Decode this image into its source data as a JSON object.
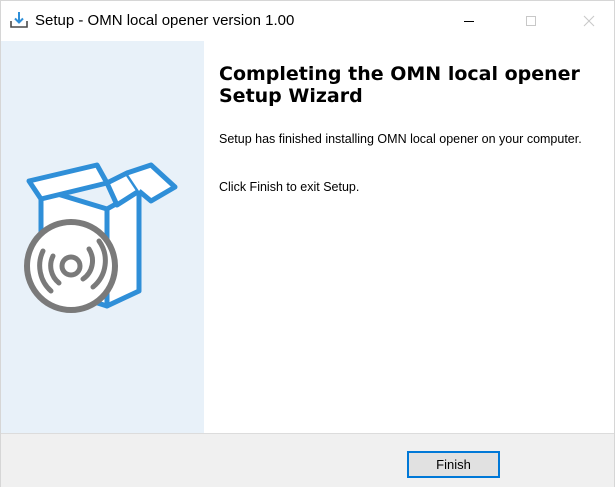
{
  "window": {
    "title": "Setup - OMN local opener version 1.00",
    "icon": "setup-download-icon",
    "controls": {
      "minimize_icon": "minimize-icon",
      "maximize_icon": "maximize-icon",
      "close_icon": "close-icon"
    }
  },
  "banner": {
    "illustration": "software-box-disc-icon",
    "background_color": "#e8f1f9",
    "accent_color": "#2f8fd8"
  },
  "content": {
    "heading": "Completing the OMN local opener Setup Wizard",
    "paragraph_1": "Setup has finished installing OMN local opener on your computer.",
    "paragraph_2": "Click Finish to exit Setup."
  },
  "footer": {
    "finish_label": "Finish",
    "focus_color": "#0078d7"
  }
}
